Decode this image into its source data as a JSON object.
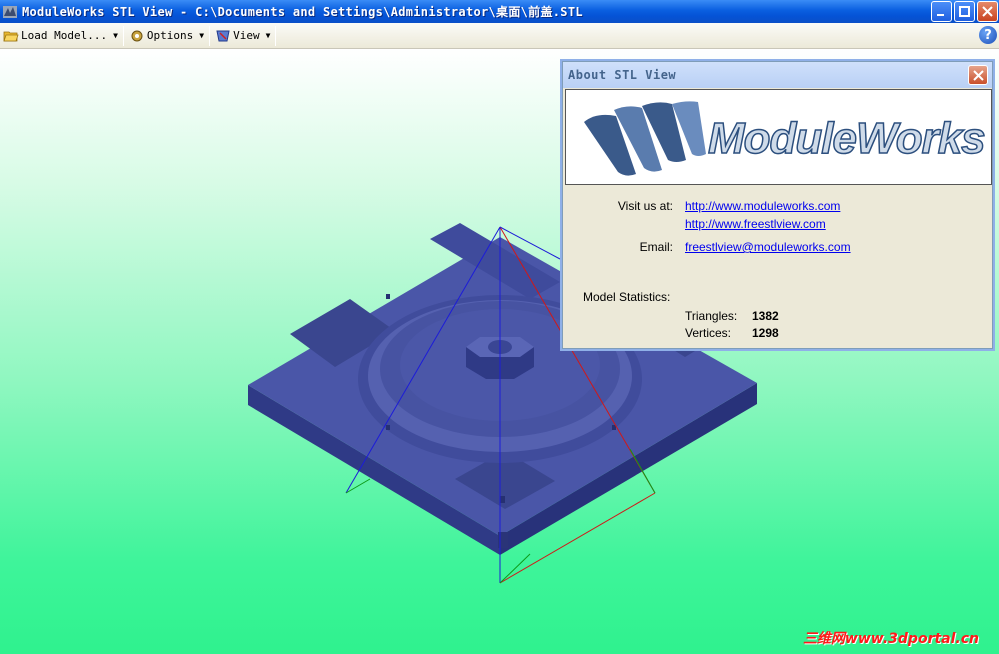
{
  "window": {
    "title": "ModuleWorks STL View - C:\\Documents and Settings\\Administrator\\桌面\\前盖.STL"
  },
  "toolbar": {
    "load_label": "Load Model...",
    "options_label": "Options",
    "view_label": "View",
    "help_label": "?"
  },
  "about": {
    "title": "About STL View",
    "logo_text": "ModuleWorks",
    "visit_label": "Visit us at:",
    "link1": "http://www.moduleworks.com",
    "link2": "http://www.freestlview.com",
    "email_label": "Email:",
    "email": "freestlview@moduleworks.com",
    "stats_label": "Model Statistics:",
    "triangles_label": "Triangles:",
    "triangles_value": "1382",
    "vertices_label": "Vertices:",
    "vertices_value": "1298"
  },
  "watermark": "三维网www.3dportal.cn",
  "colors": {
    "model": "#4a56a8",
    "model_dark": "#2f3a86",
    "axis_x": "#d01818",
    "axis_y": "#0c9a18",
    "axis_z": "#1c1cd8"
  },
  "icons": {
    "app": "app-icon",
    "load": "folder-open-icon",
    "options": "gear-icon",
    "view": "view-icon",
    "help": "help-icon",
    "close": "close-icon"
  }
}
